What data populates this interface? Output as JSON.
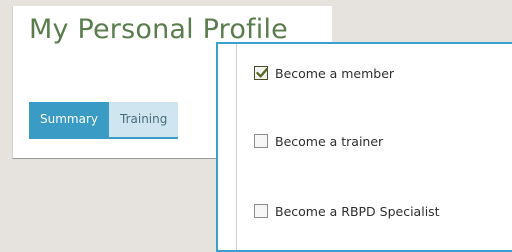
{
  "profile": {
    "title": "My Personal Profile",
    "tabs": [
      {
        "label": "Summary",
        "active": true
      },
      {
        "label": "Training",
        "active": false
      }
    ]
  },
  "options": [
    {
      "label": "Become a member",
      "checked": true
    },
    {
      "label": "Become a trainer",
      "checked": false
    },
    {
      "label": "Become a RBPD Specialist",
      "checked": false
    }
  ],
  "colors": {
    "title": "#5b7d4e",
    "tab_active": "#3a9bc4",
    "tab_inactive": "#cfe6f1",
    "panel_border": "#3aa0d0",
    "checkmark": "#5a6a2a"
  },
  "icons": {
    "checkmark": "check-icon"
  }
}
